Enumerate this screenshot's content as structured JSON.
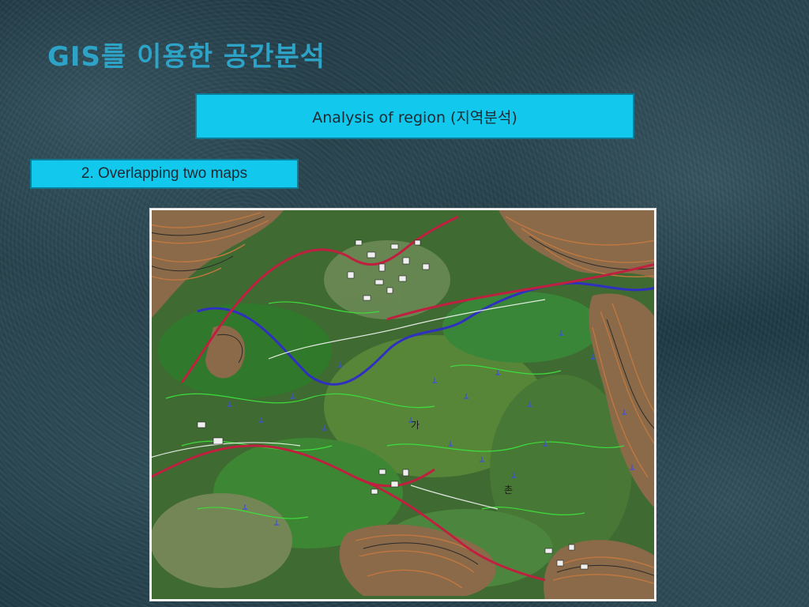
{
  "slide": {
    "title": "GIS를 이용한 공간분석",
    "banner": "Analysis of region (지역분석)",
    "step_label": "2. Overlapping two maps"
  },
  "map": {
    "labels": [
      "가",
      "촌"
    ],
    "colors": {
      "contour_brown": "#c07840",
      "contour_dark": "#2a2a2a",
      "road_red": "#c02040",
      "river_blue": "#3030c0",
      "vegetation_green": "#3a8a2a",
      "bright_green": "#3ddc3d",
      "symbol_blue": "#3a50e0"
    }
  }
}
